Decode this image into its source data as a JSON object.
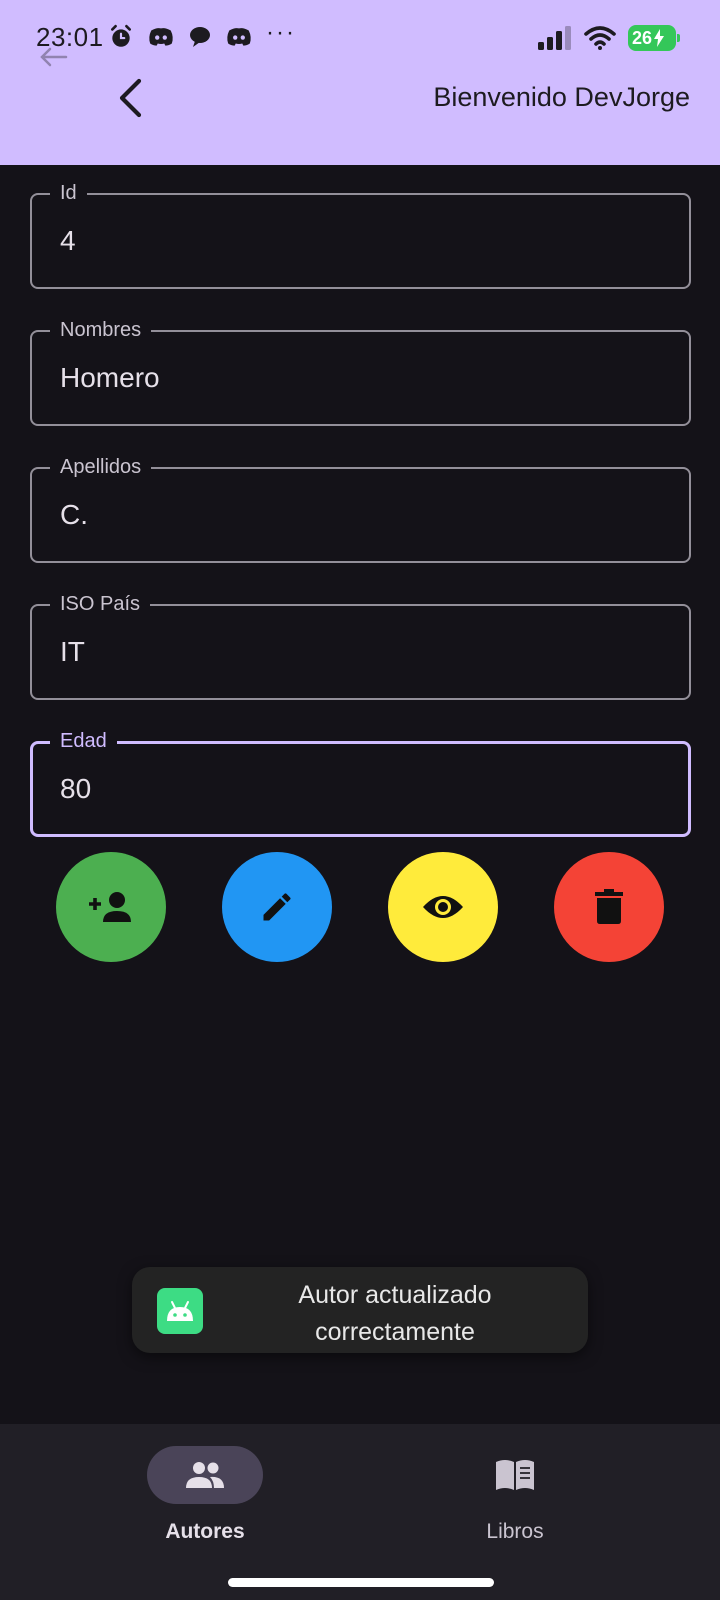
{
  "status_bar": {
    "time": "23:01",
    "battery": "26",
    "left_icons": [
      "alarm-icon",
      "discord-icon",
      "chat-bubble-icon",
      "discord-icon"
    ],
    "overflow": "···"
  },
  "app_bar": {
    "title": "Bienvenido DevJorge",
    "background": "#d0bcff"
  },
  "form": {
    "fields": [
      {
        "label": "Id",
        "value": "4"
      },
      {
        "label": "Nombres",
        "value": "Homero"
      },
      {
        "label": "Apellidos",
        "value": "C."
      },
      {
        "label": "ISO País",
        "value": "IT"
      },
      {
        "label": "Edad",
        "value": "80",
        "focused": true
      }
    ]
  },
  "actions": [
    {
      "name": "add-author",
      "icon": "person-add-icon",
      "color": "#4caf50"
    },
    {
      "name": "edit-author",
      "icon": "pencil-icon",
      "color": "#2196f3"
    },
    {
      "name": "view-author",
      "icon": "eye-icon",
      "color": "#ffeb3b"
    },
    {
      "name": "delete-author",
      "icon": "trash-icon",
      "color": "#f44336"
    }
  ],
  "toast": {
    "message": "Autor actualizado correctamente",
    "icon": "android-icon"
  },
  "bottom_nav": {
    "items": [
      {
        "label": "Autores",
        "icon": "people-icon",
        "selected": true
      },
      {
        "label": "Libros",
        "icon": "book-icon",
        "selected": false
      }
    ]
  }
}
